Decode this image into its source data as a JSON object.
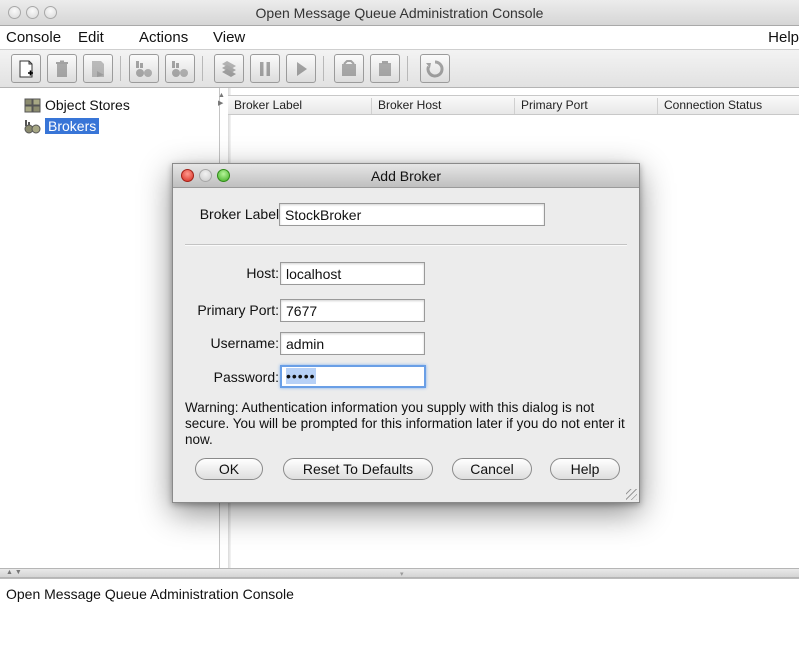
{
  "window": {
    "title": "Open Message Queue Administration Console"
  },
  "menu": [
    "Console",
    "Edit",
    "Actions",
    "View",
    "Help"
  ],
  "toolbar": [
    "add-icon",
    "delete-icon",
    "properties-icon",
    "query-broker-icon",
    "connect-broker-icon",
    "purge-icon",
    "pause-icon",
    "resume-icon",
    "shutdown-icon",
    "restart-icon",
    "refresh-icon"
  ],
  "tree": {
    "items": [
      "Object Stores",
      "Brokers"
    ],
    "selected": "Brokers"
  },
  "table": {
    "columns": [
      "Broker Label",
      "Broker Host",
      "Primary Port",
      "Connection Status"
    ]
  },
  "status": {
    "message": "Open Message Queue Administration Console"
  },
  "dialog": {
    "title": "Add Broker",
    "fields": {
      "broker_label": {
        "label": "Broker Label:",
        "value": "StockBroker"
      },
      "host": {
        "label": "Host:",
        "value": "localhost"
      },
      "primary_port": {
        "label": "Primary Port:",
        "value": "7677"
      },
      "username": {
        "label": "Username:",
        "value": "admin"
      },
      "password": {
        "label": "Password:",
        "value": "•••••"
      }
    },
    "warning": "Warning: Authentication information you supply with this dialog is not secure. You will be prompted for this information later if you do not enter it now.",
    "buttons": {
      "ok": "OK",
      "reset": "Reset To Defaults",
      "cancel": "Cancel",
      "help": "Help"
    }
  },
  "colors": {
    "selection": "#3875d7",
    "focus_ring": "#6a9fe6",
    "dialog_bg": "#ececec"
  }
}
